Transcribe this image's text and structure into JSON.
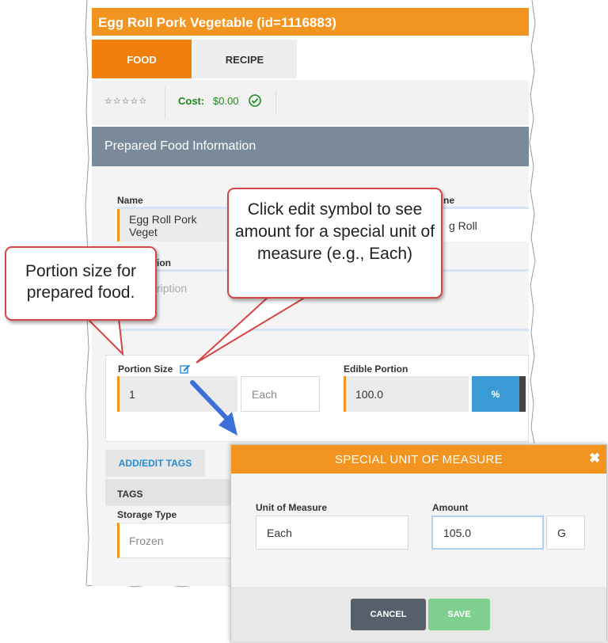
{
  "header": {
    "title": "Egg Roll Pork Vegetable (id=1116883)"
  },
  "tabs": [
    {
      "label": "FOOD",
      "active": true
    },
    {
      "label": "RECIPE",
      "active": false
    }
  ],
  "info_bar": {
    "rating_stars": "☆☆☆☆☆",
    "cost_label": "Cost:",
    "cost_value": "$0.00"
  },
  "section": {
    "title": "Prepared Food Information"
  },
  "form": {
    "name_label": "Name",
    "name_value": "Egg Roll Pork Veget",
    "second_label_partial": "ne",
    "second_value_partial": "g Roll",
    "description_label_partial": "ion",
    "description_placeholder_partial": "ription"
  },
  "portion": {
    "label": "Portion Size",
    "value": "1",
    "unit_placeholder": "Each",
    "edible_label": "Edible Portion",
    "edible_value": "100.0",
    "percent_button": "%"
  },
  "tags": {
    "add_edit_label": "ADD/EDIT TAGS",
    "header_label": "TAGS",
    "storage_label": "Storage Type",
    "storage_value": "Frozen"
  },
  "callouts": {
    "portion_note": "Portion size for prepared food.",
    "edit_note": "Click edit symbol to see amount for a special unit of measure (e.g., Each)"
  },
  "modal": {
    "title": "SPECIAL UNIT OF MEASURE",
    "close_glyph": "✖",
    "unit_label": "Unit of Measure",
    "unit_value": "Each",
    "amount_label": "Amount",
    "amount_value": "105.0",
    "amount_unit": "G",
    "cancel_label": "CANCEL",
    "save_label": "SAVE"
  },
  "colors": {
    "accent_orange": "#f29520",
    "tab_orange": "#f07f0e",
    "section_gray": "#7b8a9b",
    "percent_blue": "#3a9ad6",
    "cost_green": "#1e8a1e",
    "callout_border": "#d64545",
    "cancel_gray": "#55606a",
    "save_green": "#7fcf8f"
  },
  "icons": {
    "edit": "edit-pencil-icon",
    "cost_check": "check-circle-icon",
    "arrow": "blue-arrow-icon",
    "close": "close-icon"
  }
}
